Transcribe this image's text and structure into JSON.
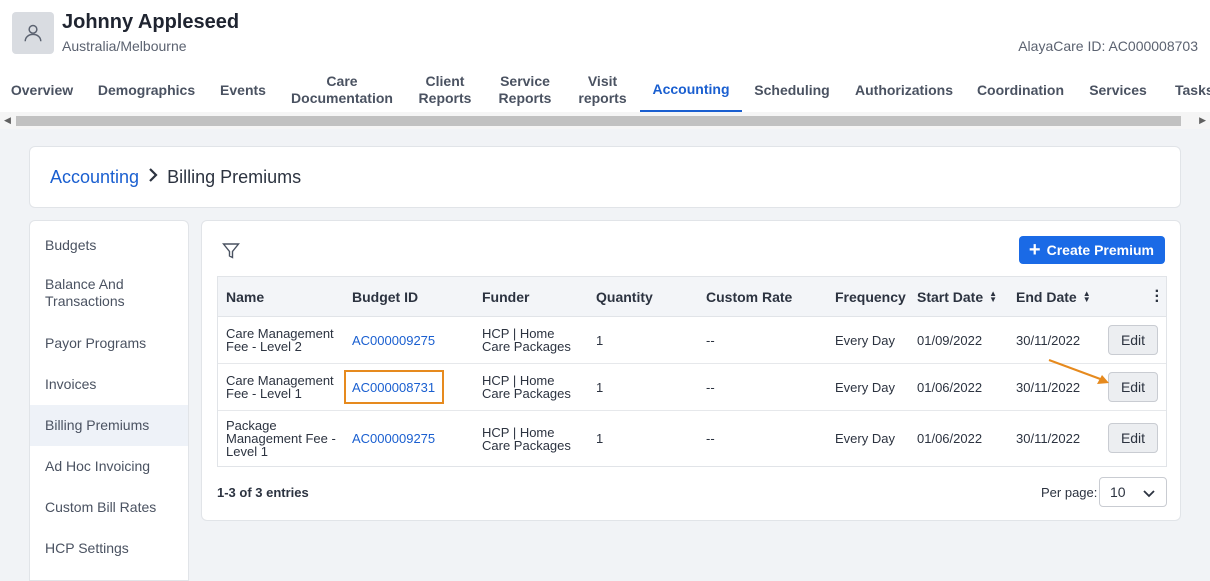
{
  "patient": {
    "name": "Johnny Appleseed",
    "timezone": "Australia/Melbourne",
    "alayacare_id": "AlayaCare ID: AC000008703"
  },
  "tabs": [
    {
      "line1": "Overview",
      "line2": ""
    },
    {
      "line1": "Demographics",
      "line2": ""
    },
    {
      "line1": "Events",
      "line2": ""
    },
    {
      "line1": "Care",
      "line2": "Documentation"
    },
    {
      "line1": "Client",
      "line2": "Reports"
    },
    {
      "line1": "Service",
      "line2": "Reports"
    },
    {
      "line1": "Visit",
      "line2": "reports"
    },
    {
      "line1": "Accounting",
      "line2": ""
    },
    {
      "line1": "Scheduling",
      "line2": ""
    },
    {
      "line1": "Authorizations",
      "line2": ""
    },
    {
      "line1": "Coordination",
      "line2": ""
    },
    {
      "line1": "Services",
      "line2": ""
    },
    {
      "line1": "Tasks",
      "line2": ""
    }
  ],
  "active_tab": "Accounting",
  "breadcrumb": {
    "parent": "Accounting",
    "current": "Billing Premiums"
  },
  "sidenav": [
    {
      "line1": "Budgets",
      "line2": ""
    },
    {
      "line1": "Balance And",
      "line2": "Transactions"
    },
    {
      "line1": "Payor Programs",
      "line2": ""
    },
    {
      "line1": "Invoices",
      "line2": ""
    },
    {
      "line1": "Billing Premiums",
      "line2": ""
    },
    {
      "line1": "Ad Hoc Invoicing",
      "line2": ""
    },
    {
      "line1": "Custom Bill Rates",
      "line2": ""
    },
    {
      "line1": "HCP Settings",
      "line2": ""
    }
  ],
  "toolbar": {
    "create_label": "Create Premium"
  },
  "table": {
    "columns": [
      "Name",
      "Budget ID",
      "Funder",
      "Quantity",
      "Custom Rate",
      "Frequency",
      "Start Date",
      "End Date"
    ],
    "rows": [
      {
        "name": [
          "Care Management",
          "Fee - Level 2"
        ],
        "budget_id": "AC000009275",
        "funder": [
          "HCP | Home",
          "Care Packages"
        ],
        "quantity": "1",
        "custom_rate": "--",
        "frequency": "Every Day",
        "start_date": "01/09/2022",
        "end_date": "30/11/2022",
        "action": "Edit"
      },
      {
        "name": [
          "Care Management",
          "Fee - Level 1"
        ],
        "budget_id": "AC000008731",
        "funder": [
          "HCP | Home",
          "Care Packages"
        ],
        "quantity": "1",
        "custom_rate": "--",
        "frequency": "Every Day",
        "start_date": "01/06/2022",
        "end_date": "30/11/2022",
        "action": "Edit"
      },
      {
        "name": [
          "Package",
          "Management Fee -",
          "Level 1"
        ],
        "budget_id": "AC000009275",
        "funder": [
          "HCP | Home",
          "Care Packages"
        ],
        "quantity": "1",
        "custom_rate": "--",
        "frequency": "Every Day",
        "start_date": "01/06/2022",
        "end_date": "30/11/2022",
        "action": "Edit"
      }
    ]
  },
  "footer": {
    "entries": "1-3 of 3 entries",
    "per_page_label": "Per page:",
    "per_page_value": "10"
  },
  "colors": {
    "accent": "#1a5fd0",
    "primary_button": "#1a6ae6",
    "highlight": "#e68a1e"
  }
}
